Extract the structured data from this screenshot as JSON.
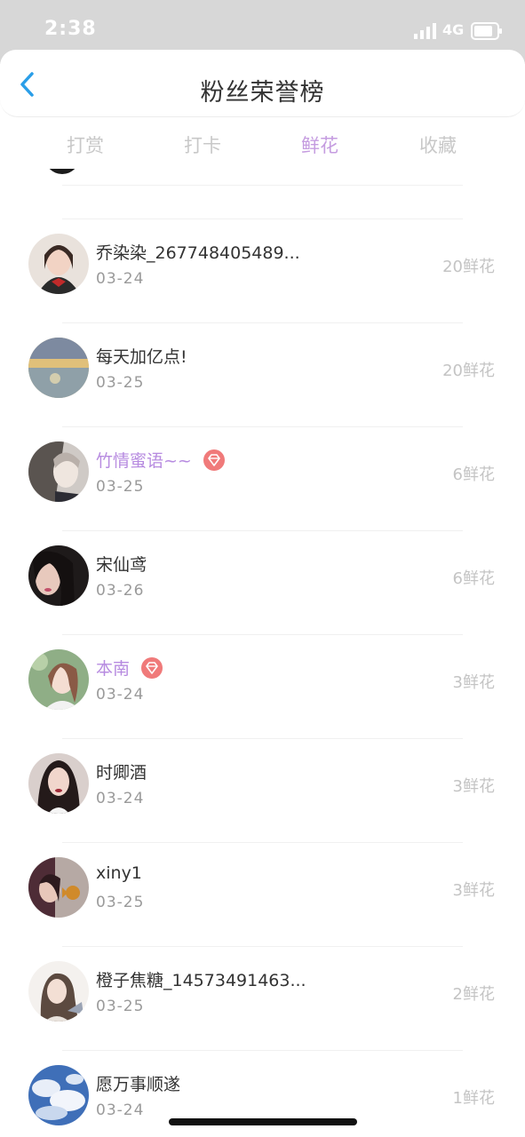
{
  "status_bar": {
    "time": "2:38",
    "network": "4G",
    "icons": [
      "signal-icon",
      "battery-icon"
    ]
  },
  "header": {
    "title": "粉丝荣誉榜",
    "back_icon": "chevron-left-icon",
    "accent_color": "#2a9ee8"
  },
  "tabs": [
    {
      "label": "打赏",
      "active": false
    },
    {
      "label": "打卡",
      "active": false
    },
    {
      "label": "鲜花",
      "active": true
    },
    {
      "label": "收藏",
      "active": false
    }
  ],
  "active_tab_color": "#c59ce0",
  "fans": [
    {
      "name": "乔染染_267748405489...",
      "date": "03-24",
      "amount": "20鲜花",
      "vip": false
    },
    {
      "name": "每天加亿点!",
      "date": "03-25",
      "amount": "20鲜花",
      "vip": false
    },
    {
      "name": "竹情蜜语~~",
      "date": "03-25",
      "amount": "6鲜花",
      "vip": true
    },
    {
      "name": "宋仙鸢",
      "date": "03-26",
      "amount": "6鲜花",
      "vip": false
    },
    {
      "name": "本南",
      "date": "03-24",
      "amount": "3鲜花",
      "vip": true
    },
    {
      "name": "时卿酒",
      "date": "03-24",
      "amount": "3鲜花",
      "vip": false
    },
    {
      "name": "xiny1",
      "date": "03-25",
      "amount": "3鲜花",
      "vip": false
    },
    {
      "name": "橙子焦糖_14573491463...",
      "date": "03-25",
      "amount": "2鲜花",
      "vip": false
    },
    {
      "name": "愿万事顺遂",
      "date": "03-24",
      "amount": "1鲜花",
      "vip": false
    }
  ],
  "vip_badge_icon": "diamond-badge-icon",
  "vip_color": "#f07a7a"
}
